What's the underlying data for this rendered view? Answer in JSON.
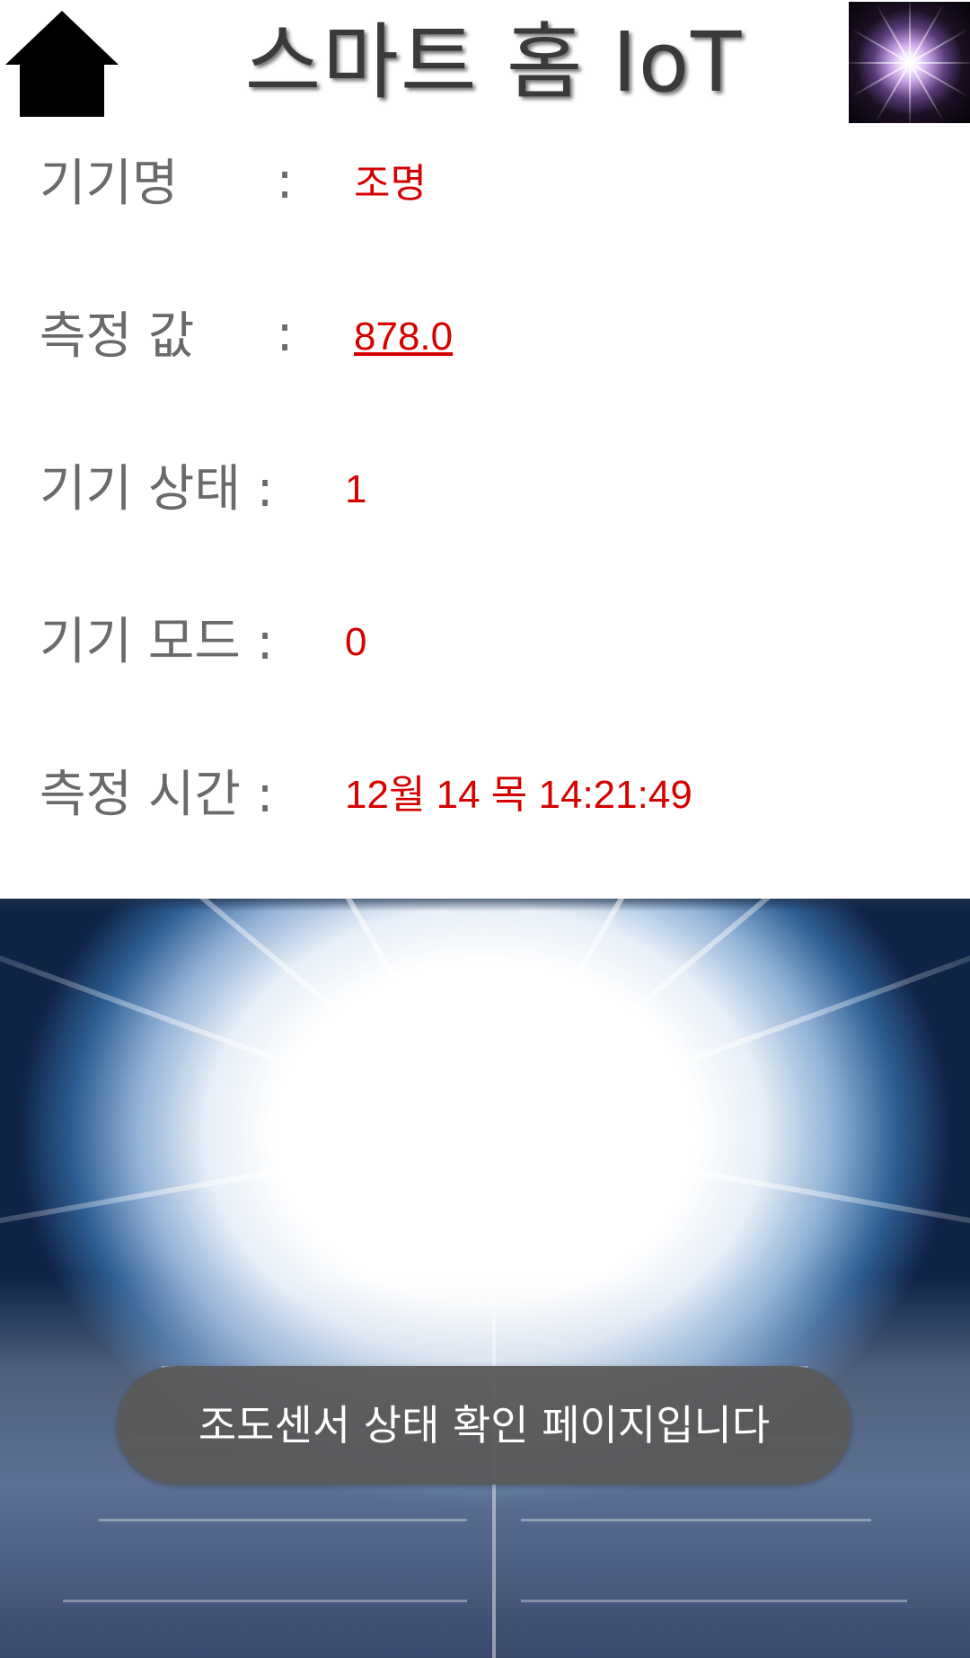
{
  "header": {
    "title": "스마트 홈 IoT",
    "home_icon": "home-icon",
    "thumbnail": "light-burst-thumbnail"
  },
  "device": {
    "name_label": "기기명",
    "name_colon": ":",
    "name_value": "조명",
    "measure_label": "측정 값",
    "measure_colon": ":",
    "measure_value": "878.0",
    "status_label": "기기 상태 :",
    "status_value": "1",
    "mode_label": "기기 모드 :",
    "mode_value": "0",
    "time_label": "측정 시간 :",
    "time_value": "12월 14 목 14:21:49"
  },
  "toast": {
    "message": "조도센서 상태 확인 페이지입니다"
  },
  "colors": {
    "value_red": "#d50000",
    "label_gray": "#6a6a6a",
    "toast_bg": "#585858"
  }
}
